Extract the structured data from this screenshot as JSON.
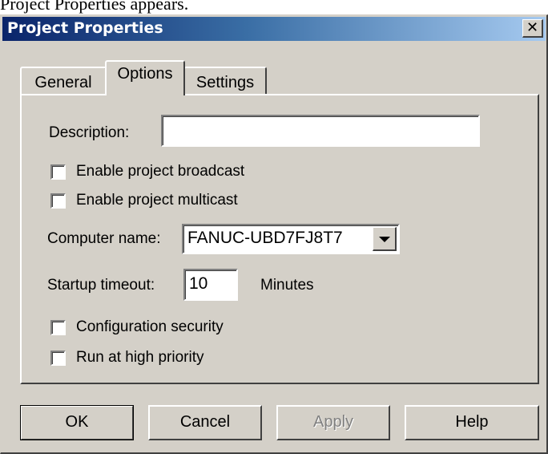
{
  "caption": "Project Properties appears.",
  "window": {
    "title": "Project Properties",
    "close_glyph": "✕"
  },
  "tabs": [
    {
      "label": "General",
      "active": false
    },
    {
      "label": "Options",
      "active": true
    },
    {
      "label": "Settings",
      "active": false
    }
  ],
  "options": {
    "description": {
      "label": "Description:",
      "value": ""
    },
    "broadcast": {
      "label": "Enable project broadcast",
      "checked": false
    },
    "multicast": {
      "label": "Enable project multicast",
      "checked": false
    },
    "computer_name": {
      "label": "Computer name:",
      "value": "FANUC-UBD7FJ8T7"
    },
    "startup_timeout": {
      "label": "Startup timeout:",
      "value": "10",
      "unit": "Minutes"
    },
    "config_security": {
      "label": "Configuration security",
      "checked": false
    },
    "high_priority": {
      "label": "Run at high priority",
      "checked": false
    }
  },
  "buttons": {
    "ok": "OK",
    "cancel": "Cancel",
    "apply": "Apply",
    "help": "Help"
  },
  "colors": {
    "face": "#d4d0c8",
    "title_start": "#0a246a",
    "title_end": "#a6caf0"
  }
}
